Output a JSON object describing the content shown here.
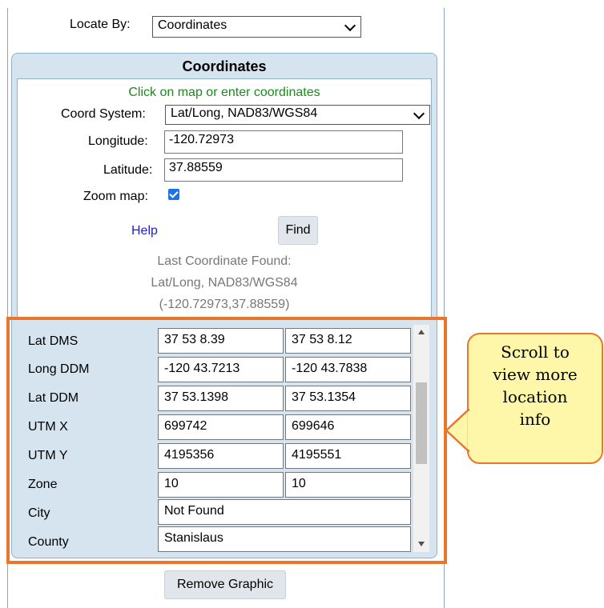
{
  "locate": {
    "label": "Locate By:",
    "value": "Coordinates"
  },
  "coordinates": {
    "title": "Coordinates",
    "instruction": "Click on map or enter coordinates",
    "coord_system_label": "Coord System:",
    "coord_system_value": "Lat/Long, NAD83/WGS84",
    "longitude_label": "Longitude:",
    "longitude_value": "-120.72973",
    "latitude_label": "Latitude:",
    "latitude_value": "37.88559",
    "zoom_label": "Zoom map:",
    "zoom_checked": true,
    "help_link": "Help",
    "find_button": "Find",
    "last_found_title": "Last Coordinate Found:",
    "last_found_system": "Lat/Long, NAD83/WGS84",
    "last_found_value": "(-120.72973,37.88559)"
  },
  "table": {
    "rows": [
      {
        "label": "Lat DMS",
        "v1": "37 53 8.39",
        "v2": "37 53 8.12"
      },
      {
        "label": "Long DDM",
        "v1": "-120 43.7213",
        "v2": "-120 43.7838"
      },
      {
        "label": "Lat DDM",
        "v1": "37 53.1398",
        "v2": "37 53.1354"
      },
      {
        "label": "UTM X",
        "v1": "699742",
        "v2": "699646"
      },
      {
        "label": "UTM Y",
        "v1": "4195356",
        "v2": "4195551"
      },
      {
        "label": "Zone",
        "v1": "10",
        "v2": "10"
      },
      {
        "label": "City",
        "v1": "Not Found"
      },
      {
        "label": "County",
        "v1": "Stanislaus"
      }
    ]
  },
  "remove_button": "Remove Graphic",
  "callout": {
    "line1": "Scroll to",
    "line2": "view more",
    "line3": "location",
    "line4": "info"
  },
  "colors": {
    "accent_orange": "#e9762b",
    "panel_blue": "#d6e4ef",
    "callout_yellow": "#fef6a8",
    "link_blue": "#1a1ae6",
    "instruction_green": "#1a8a1a",
    "checkbox_blue": "#1a73e8"
  },
  "icons": {
    "dropdown": "chevron-down-icon",
    "checkbox": "checkmark-icon",
    "scroll_up": "arrow-up-icon",
    "scroll_down": "arrow-down-icon"
  }
}
